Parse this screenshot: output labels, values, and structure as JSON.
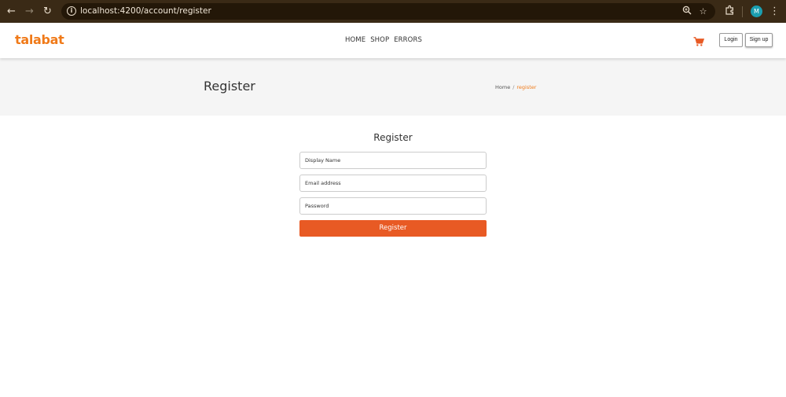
{
  "browser": {
    "url": "localhost:4200/account/register",
    "profile_initial": "M"
  },
  "header": {
    "logo": "talabat",
    "nav": [
      "HOME",
      "SHOP",
      "ERRORS"
    ],
    "login_label": "Login",
    "signup_label": "Sign up"
  },
  "hero": {
    "title": "Register",
    "breadcrumb": {
      "home": "Home",
      "separator": "/",
      "current": "register"
    }
  },
  "form": {
    "title": "Register",
    "display_name_placeholder": "Display Name",
    "email_placeholder": "Email address",
    "password_placeholder": "Password",
    "submit_label": "Register"
  },
  "colors": {
    "brand": "#f07a19",
    "button": "#e85a24",
    "browser_chrome": "#3a2a16"
  }
}
